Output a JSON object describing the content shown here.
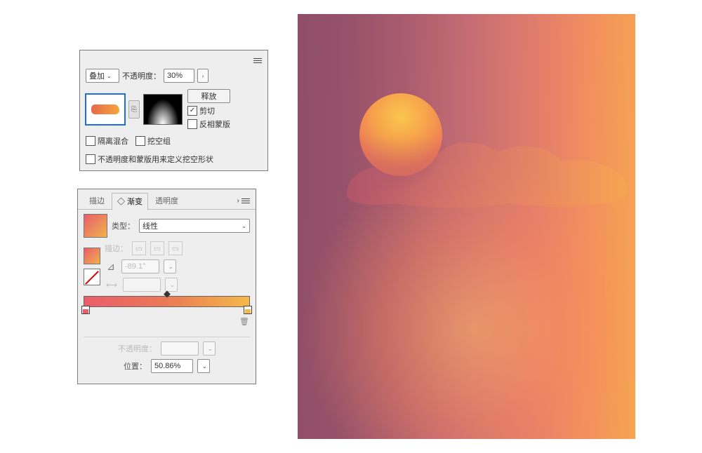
{
  "transparency_panel": {
    "blend_mode_selected": "叠加",
    "opacity_label": "不透明度：",
    "opacity_value": "30%",
    "release_btn_label": "释放",
    "clip_label": "剪切",
    "clip_checked": true,
    "invert_mask_label": "反相蒙版",
    "invert_mask_checked": false,
    "isolate_blend_label": "隔离混合",
    "isolate_blend_checked": false,
    "knockout_label": "挖空组",
    "knockout_checked": false,
    "define_shape_label": "不透明度和蒙版用来定义挖空形状",
    "define_shape_checked": false
  },
  "gradient_panel": {
    "tabs": {
      "stroke": "描边",
      "gradient": "◇ 渐变",
      "transparency": "透明度"
    },
    "active_tab": "gradient",
    "type_label": "类型：",
    "type_value": "线性",
    "stroke_label": "描边：",
    "angle_icon": "⊿",
    "angle_value": "-89.1°",
    "spacing_icon": "↔",
    "gradient_colors": {
      "left": "#ea5d6b",
      "mid": "#eb7a55",
      "right": "#f6b84a"
    },
    "midpoint_percent": 50,
    "opacity_label": "不透明度：",
    "opacity_value": "",
    "position_label": "位置：",
    "position_value": "50.86%"
  },
  "artwork": {
    "gradient_angle": -89.1,
    "sun_present": true,
    "cloud_overlay_opacity": 0.3
  }
}
